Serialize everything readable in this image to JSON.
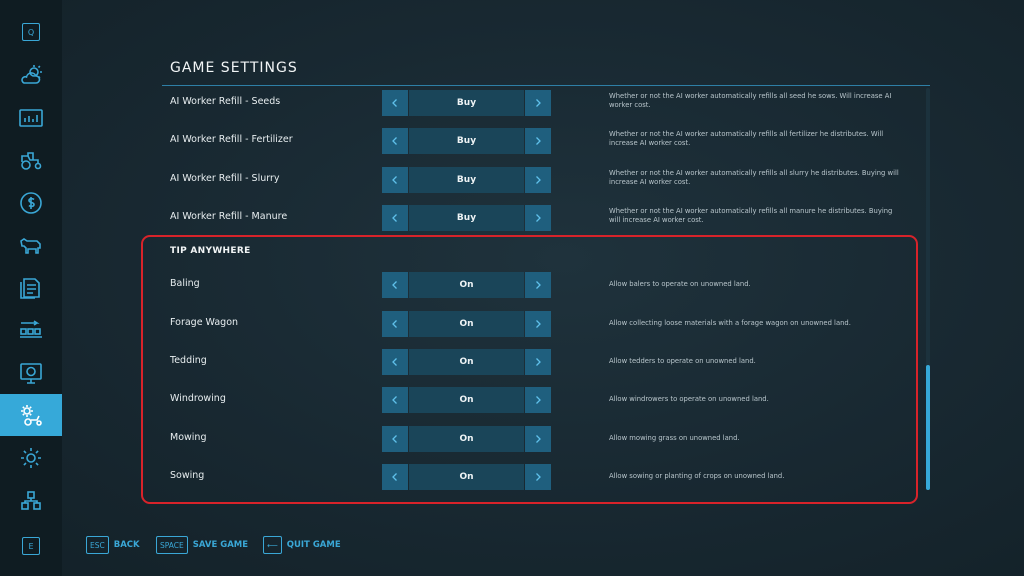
{
  "sidebar": {
    "top_key": "Q",
    "bottom_key": "E",
    "items": [
      {
        "icon": "weather-icon"
      },
      {
        "icon": "statistics-icon"
      },
      {
        "icon": "vehicles-icon"
      },
      {
        "icon": "finances-icon"
      },
      {
        "icon": "animals-icon"
      },
      {
        "icon": "contracts-icon"
      },
      {
        "icon": "production-icon"
      },
      {
        "icon": "help-icon"
      },
      {
        "icon": "game-settings-icon",
        "active": true
      },
      {
        "icon": "general-settings-icon"
      },
      {
        "icon": "mods-icon"
      }
    ]
  },
  "header": {
    "title": "GAME SETTINGS"
  },
  "settings": [
    {
      "label": "AI Worker Refill - Seeds",
      "value": "Buy",
      "desc": "Whether or not the AI worker automatically refills all seed he sows. Will increase AI worker cost."
    },
    {
      "label": "AI Worker Refill - Fertilizer",
      "value": "Buy",
      "desc": "Whether or not the AI worker automatically refills all fertilizer he distributes. Will increase AI worker cost."
    },
    {
      "label": "AI Worker Refill - Slurry",
      "value": "Buy",
      "desc": "Whether or not the AI worker automatically refills all slurry he distributes. Buying will increase AI worker cost."
    },
    {
      "label": "AI Worker Refill - Manure",
      "value": "Buy",
      "desc": "Whether or not the AI worker automatically refills all manure he distributes. Buying will increase AI worker cost."
    }
  ],
  "tip_section": {
    "heading": "TIP ANYWHERE",
    "rows": [
      {
        "label": "Baling",
        "value": "On",
        "desc": "Allow balers to operate on unowned land."
      },
      {
        "label": "Forage Wagon",
        "value": "On",
        "desc": "Allow collecting loose materials with a forage wagon on unowned land."
      },
      {
        "label": "Tedding",
        "value": "On",
        "desc": "Allow tedders to operate on unowned land."
      },
      {
        "label": "Windrowing",
        "value": "On",
        "desc": "Allow windrowers to operate on unowned land."
      },
      {
        "label": "Mowing",
        "value": "On",
        "desc": "Allow mowing grass on unowned land."
      },
      {
        "label": "Sowing",
        "value": "On",
        "desc": "Allow sowing or planting of crops on unowned land."
      }
    ]
  },
  "footer": {
    "back_key": "ESC",
    "back_label": "BACK",
    "save_key": "SPACE",
    "save_label": "SAVE GAME",
    "quit_key": "⟵",
    "quit_label": "QUIT GAME"
  },
  "colors": {
    "accent": "#36a9d9",
    "highlight": "#d8232a",
    "background": "#182831"
  }
}
